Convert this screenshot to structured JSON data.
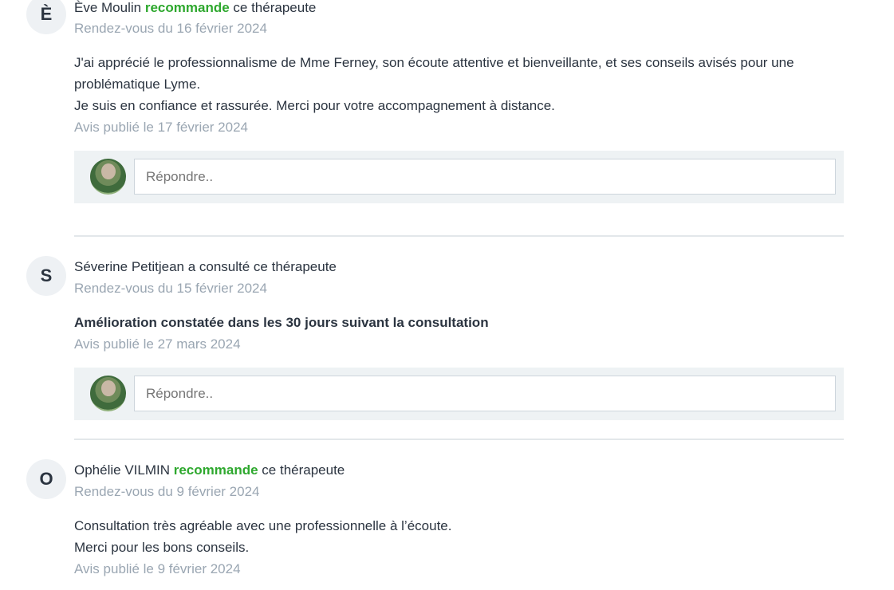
{
  "reviews": [
    {
      "initial": "È",
      "name": "Ève Moulin",
      "verb": "recommande",
      "suffix": "ce thérapeute",
      "appointment": "Rendez-vous du 16 février 2024",
      "text_lines": [
        "J'ai apprécié le professionnalisme de Mme Ferney, son écoute attentive et bienveillante, et ses conseils avisés pour une",
        "problématique Lyme.",
        "Je suis en confiance et rassurée. Merci pour votre accompagnement à distance."
      ],
      "published": "Avis publié le 17 février 2024",
      "reply_placeholder": "Répondre.."
    },
    {
      "initial": "S",
      "name": "Séverine Petitjean a consulté ce thérapeute",
      "appointment": "Rendez-vous du 15 février 2024",
      "highlight": "Amélioration constatée dans les 30 jours suivant la consultation",
      "published": "Avis publié le 27 mars 2024",
      "reply_placeholder": "Répondre.."
    },
    {
      "initial": "O",
      "name": "Ophélie VILMIN",
      "verb": "recommande",
      "suffix": "ce thérapeute",
      "appointment": "Rendez-vous du 9 février 2024",
      "text_lines": [
        "Consultation très agréable avec une professionnelle à l’écoute.",
        "Merci pour les bons conseils."
      ],
      "published": "Avis publié le 9 février 2024"
    }
  ],
  "colors": {
    "recommend": "#2ea82e",
    "muted": "#9aa6b2",
    "text": "#2b3440",
    "reply_bg": "#eef2f4"
  }
}
